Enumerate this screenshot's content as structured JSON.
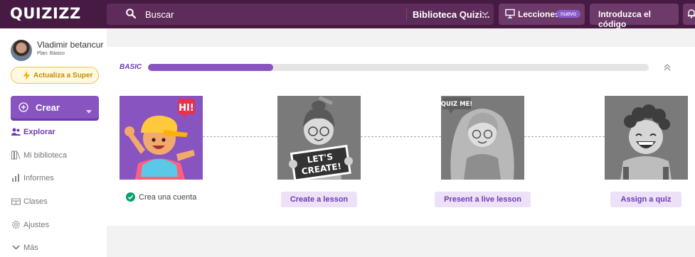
{
  "topbar": {
    "logo": "QUIZIZZ",
    "search_placeholder": "Buscar",
    "library_selector": "Biblioteca Quizi...",
    "lessons_label": "Lecciones",
    "lessons_badge": "nuevo",
    "enter_code_label": "Introduzca el código",
    "icons": [
      "search-icon",
      "chevron-down-icon",
      "presentation-icon",
      "bell-icon"
    ]
  },
  "sidebar": {
    "user_name": "Vladimir betancur",
    "plan": "Plan: Básico",
    "upgrade_label": "Actualiza a Super",
    "create_label": "Crear",
    "nav": [
      {
        "label": "Explorar",
        "icon": "explore-icon",
        "active": true
      },
      {
        "label": "Mi biblioteca",
        "icon": "library-icon",
        "active": false
      },
      {
        "label": "Informes",
        "icon": "reports-icon",
        "active": false
      },
      {
        "label": "Clases",
        "icon": "classes-icon",
        "active": false
      },
      {
        "label": "Ajustes",
        "icon": "gear-icon",
        "active": false
      },
      {
        "label": "Más",
        "icon": "chevron-down-icon",
        "active": false
      }
    ]
  },
  "onboarding": {
    "level_label": "BASIC",
    "progress_fraction": 0.25,
    "steps": [
      {
        "kind": "done",
        "label": "Crea una cuenta",
        "sticker": "HI!"
      },
      {
        "kind": "action",
        "label": "Create a lesson",
        "sign": [
          "LET'S",
          "CREATE!"
        ]
      },
      {
        "kind": "action",
        "label": "Present a live lesson",
        "sticker": "QUIZ ME!"
      },
      {
        "kind": "action",
        "label": "Assign a quiz"
      }
    ]
  },
  "colors": {
    "topbar": "#461a42",
    "accent": "#8854c0",
    "upgrade_border": "#f2c447",
    "success": "#00a06b"
  }
}
